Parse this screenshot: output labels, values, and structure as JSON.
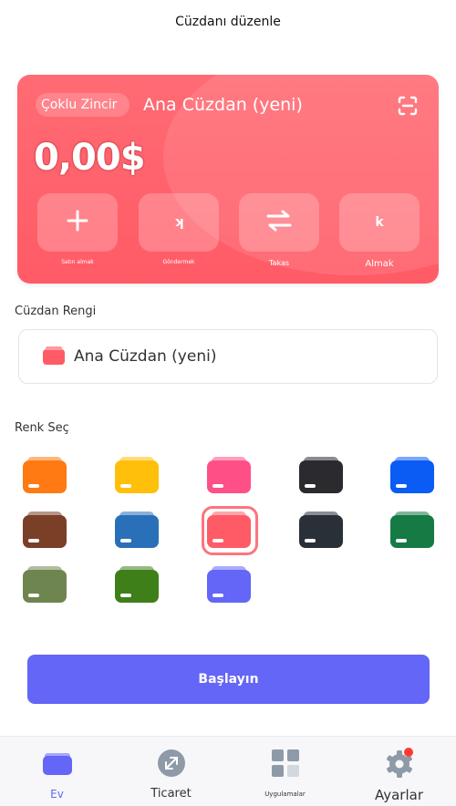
{
  "header": {
    "title": "Cüzdanı düzenle"
  },
  "card": {
    "chain_label": "Çoklu Zincir",
    "wallet_name": "Ana Cüzdan (yeni)",
    "balance": "0,00$",
    "actions": [
      {
        "label": "Satın almak",
        "icon": "plus-icon"
      },
      {
        "label": "Göndermek",
        "icon": "send-icon",
        "glyph": "ʞ"
      },
      {
        "label": "Takas",
        "icon": "swap-icon"
      },
      {
        "label": "Almak",
        "icon": "receive-icon",
        "glyph": "k"
      }
    ]
  },
  "wallet_color": {
    "label": "Cüzdan Rengi",
    "name_value": "Ana Cüzdan (yeni)"
  },
  "colors": {
    "label": "Renk Seç",
    "selected": "#ff5b66",
    "swatches": [
      "#ff7a12",
      "#ffbf0a",
      "#ff4f87",
      "#2b2b2f",
      "#0b5cf4",
      "#7a3f27",
      "#2a70b8",
      "#ff5b66",
      "#2a3038",
      "#167a45",
      "#6f8550",
      "#3f7f19",
      "#6366f7"
    ]
  },
  "start_button": {
    "label": "Başlayın"
  },
  "tabbar": {
    "tabs": [
      {
        "label": "Ev",
        "icon": "wallet-icon",
        "active": true
      },
      {
        "label": "Ticaret",
        "icon": "trade-icon"
      },
      {
        "label": "Uygulamalar",
        "icon": "apps-grid-icon"
      },
      {
        "label": "Ayarlar",
        "icon": "gear-icon"
      }
    ],
    "accent": "#6366f7",
    "badge_color": "#ff3b30"
  }
}
